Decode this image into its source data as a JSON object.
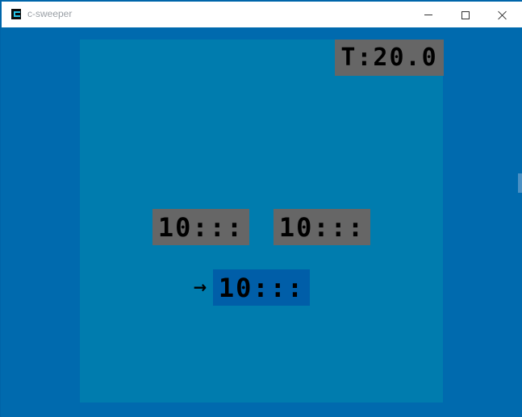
{
  "window": {
    "title": "c-sweeper",
    "icon": "app-icon",
    "controls": {
      "minimize_icon": "minimize-icon",
      "maximize_icon": "maximize-icon",
      "close_icon": "close-icon"
    }
  },
  "colors": {
    "window_bg": "#006aae",
    "board_bg": "#007cae",
    "panel_gray": "#666666",
    "panel_selected": "#005ea8",
    "text": "#000000"
  },
  "hud": {
    "timer": "T:20.0"
  },
  "scores": [
    {
      "label": "10:::"
    },
    {
      "label": "10:::"
    }
  ],
  "selection": {
    "pointer_icon": "right-arrow-icon",
    "pointer_glyph": "→",
    "label": "10:::"
  }
}
